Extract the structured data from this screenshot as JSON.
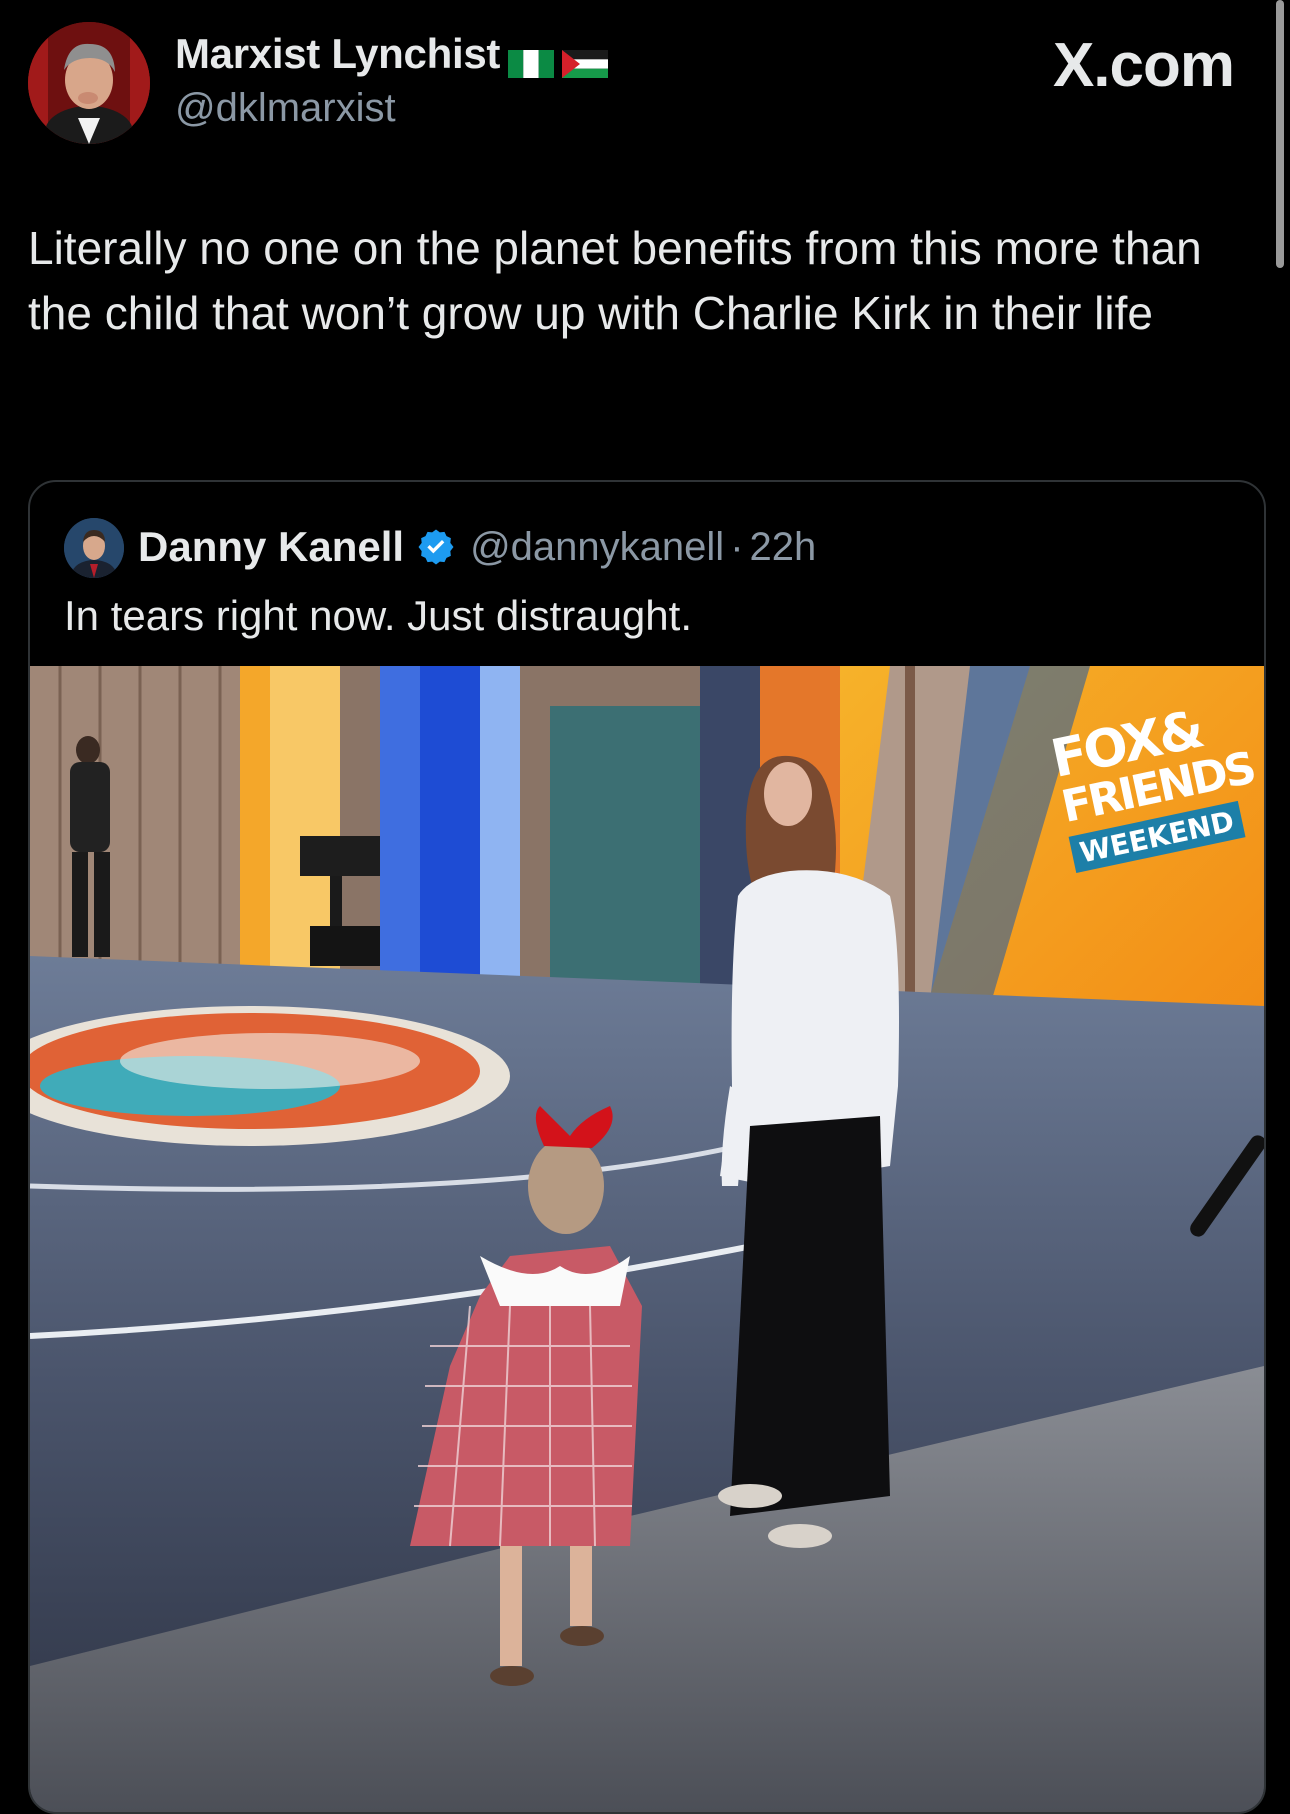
{
  "post": {
    "author_name": "Marxist Lynchist",
    "author_handle": "@dklmarxist",
    "author_flags": [
      "nigeria-flag",
      "palestine-flag"
    ],
    "text": "Literally no one on the planet benefits from this more than the child that won’t grow up with Charlie Kirk in their life"
  },
  "brand": {
    "label": "X.com"
  },
  "quote": {
    "author_name": "Danny Kanell",
    "verified": true,
    "author_handle": "@dannykanell",
    "separator": "·",
    "time": "22h",
    "text": "In tears right now. Just distraught.",
    "media": {
      "logo_line1": "FOX&",
      "logo_line2": "FRIENDS",
      "logo_line3": "WEEKEND"
    }
  },
  "colors": {
    "background": "#000000",
    "text_primary": "#e7e9ea",
    "text_secondary": "#8b98a5",
    "card_border": "#2f3336",
    "verified_blue": "#1d9bf0"
  }
}
